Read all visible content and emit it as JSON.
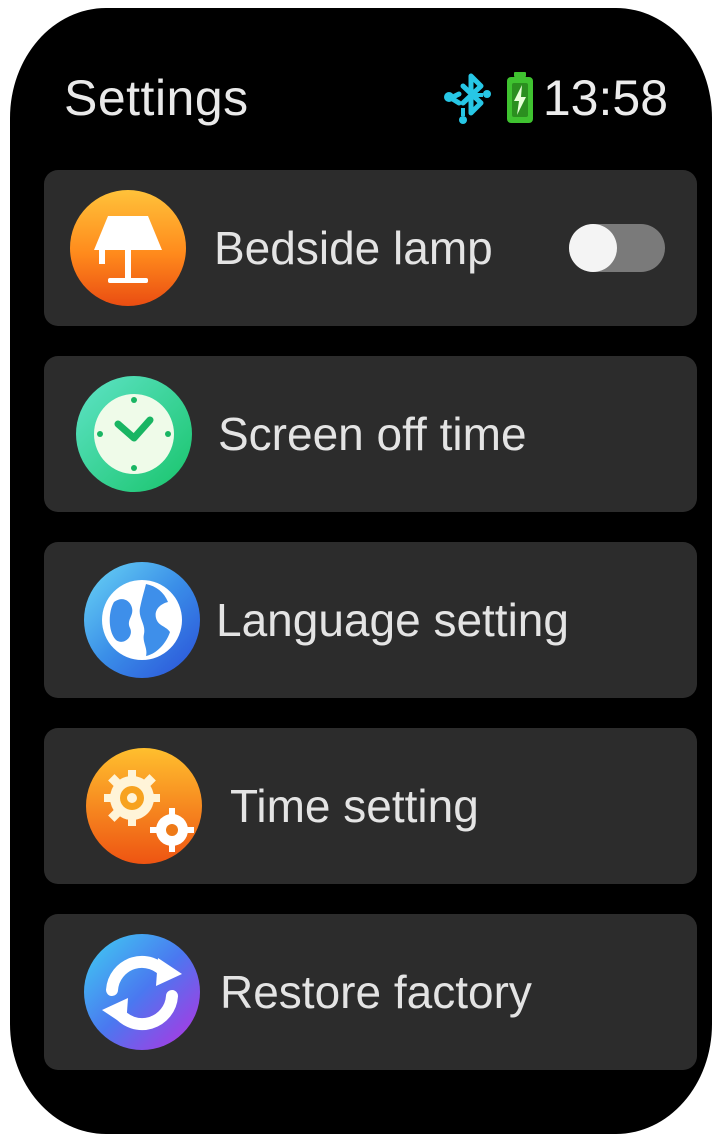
{
  "header": {
    "title": "Settings",
    "time": "13:58",
    "bluetooth_icon": "bluetooth-icon",
    "battery_icon": "battery-charging-icon",
    "colors": {
      "bluetooth": "#27c7e6",
      "battery": "#3fc230"
    }
  },
  "menu": {
    "items": [
      {
        "label": "Bedside lamp",
        "icon": "lamp-icon",
        "toggle": {
          "on": false
        }
      },
      {
        "label": "Screen off time",
        "icon": "clock-icon"
      },
      {
        "label": "Language setting",
        "icon": "globe-icon"
      },
      {
        "label": "Time setting",
        "icon": "gears-icon"
      },
      {
        "label": "Restore factory",
        "icon": "restore-icon"
      }
    ]
  },
  "colors": {
    "background": "#000000",
    "card": "#2c2c2c",
    "text": "#e4e4e4",
    "toggle_track": "#7a7a7a",
    "toggle_knob": "#f4f4f4"
  }
}
